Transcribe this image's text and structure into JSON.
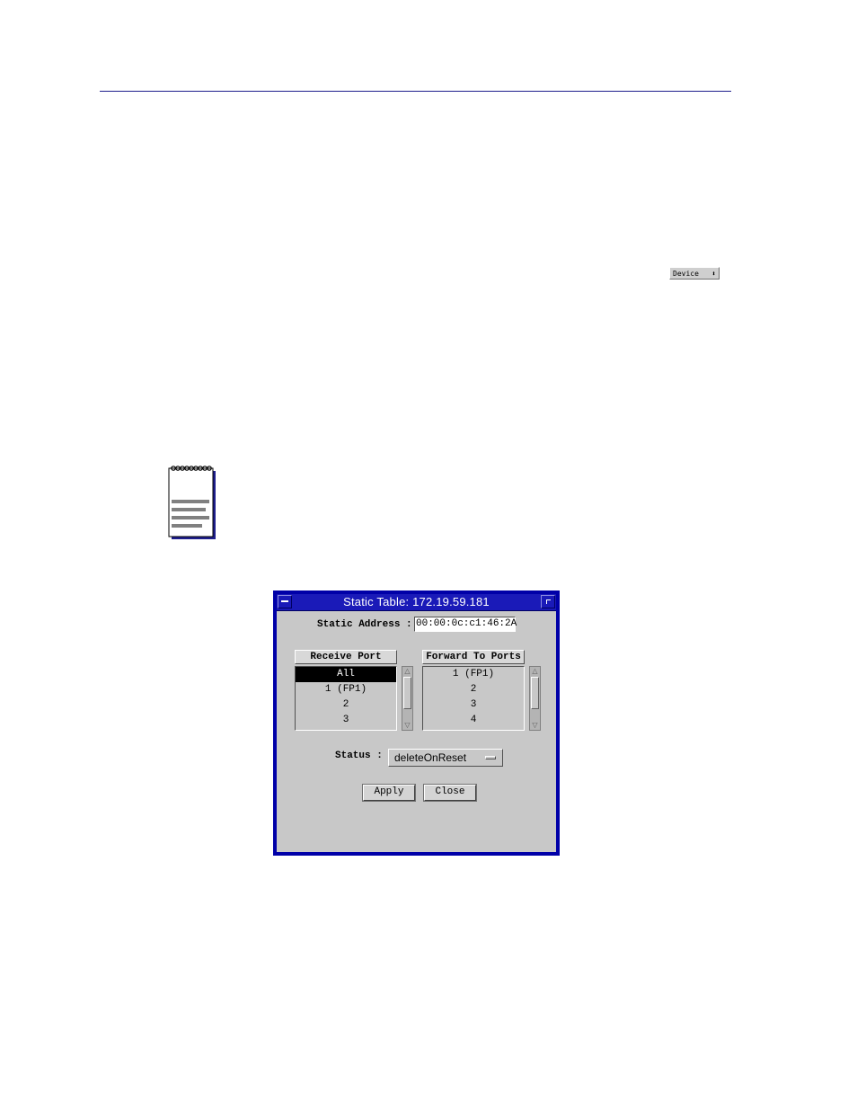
{
  "device_menu": {
    "label": "Device",
    "arrow": "⬍"
  },
  "window": {
    "title": "Static Table: 172.19.59.181",
    "static_address_label": "Static Address :",
    "static_address_value": "00:00:0c:c1:46:2A",
    "receive_port": {
      "header": "Receive Port",
      "items": [
        "All",
        "1 (FP1)",
        "2",
        "3"
      ],
      "selected_index": 0
    },
    "forward_ports": {
      "header": "Forward To Ports",
      "items": [
        "1 (FP1)",
        "2",
        "3",
        "4"
      ]
    },
    "status_label": "Status :",
    "status_value": "deleteOnReset",
    "apply_label": "Apply",
    "close_label": "Close"
  },
  "colors": {
    "header_rule": "#1e1e8c",
    "window_frame": "#0000a8",
    "dialog_background": "#c8c8c8",
    "selection": "#000000"
  },
  "icons": {
    "note": "spiral-notepad-icon",
    "window_menu": "window-menu-icon",
    "window_maximize": "window-maximize-icon",
    "scroll_up": "scroll-up-arrow-icon",
    "scroll_down": "scroll-down-arrow-icon"
  }
}
